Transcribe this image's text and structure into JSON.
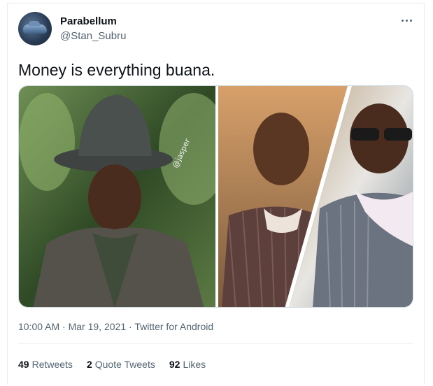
{
  "tweet": {
    "author_name": "Parabellum",
    "author_handle": "@Stan_Subru",
    "text": "Money is everything buana.",
    "media_watermark": "@jasper",
    "time": "10:00 AM",
    "separator": "·",
    "date": "Mar 19, 2021",
    "source": "Twitter for Android"
  },
  "stats": {
    "retweets_count": "49",
    "retweets_label": "Retweets",
    "quotes_count": "2",
    "quotes_label": "Quote Tweets",
    "likes_count": "92",
    "likes_label": "Likes"
  },
  "icons": {
    "more": "more-horizontal-icon"
  },
  "colors": {
    "text": "#0f1419",
    "secondary": "#536471",
    "border": "#cfd9de"
  }
}
